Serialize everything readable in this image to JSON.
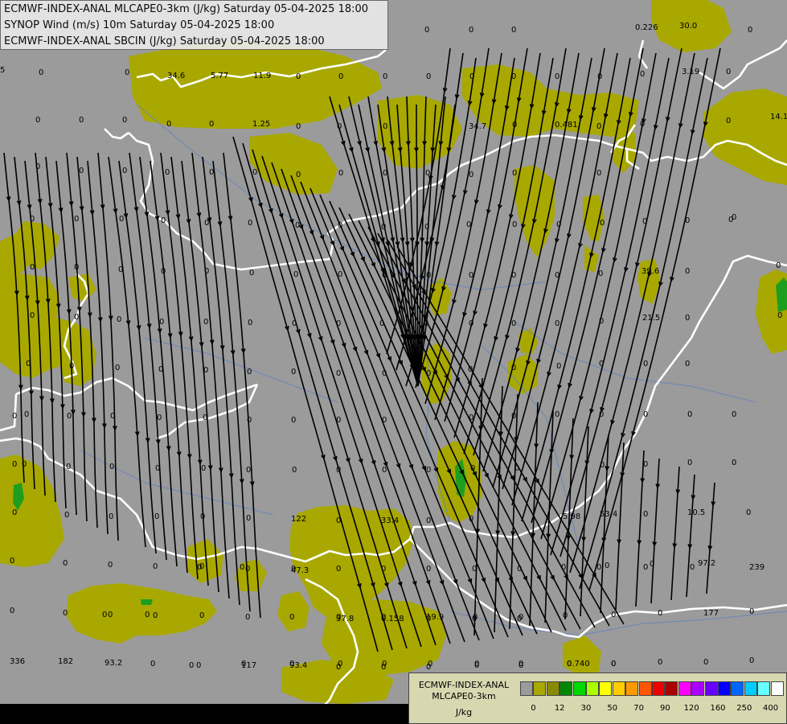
{
  "header": {
    "line1": "ECMWF-INDEX-ANAL MLCAPE0-3km (J/kg) Saturday 05-04-2025 18:00",
    "line2": "SYNOP Wind (m/s) 10m Saturday 05-04-2025 18:00",
    "line3": "ECMWF-INDEX-ANAL SBCIN (J/kg) Saturday 05-04-2025 18:00"
  },
  "legend": {
    "title1": "ECMWF-INDEX-ANAL",
    "title2": "MLCAPE0-3km",
    "units": "J/kg",
    "colors": [
      "#9b9b9b",
      "#a8a800",
      "#8a8a00",
      "#008800",
      "#00d800",
      "#aaff00",
      "#ffff00",
      "#ffcc00",
      "#ff9900",
      "#ff5500",
      "#ee0000",
      "#aa0000",
      "#ff00ff",
      "#aa00ff",
      "#6600ff",
      "#0000ff",
      "#0066ff",
      "#00ccff",
      "#66ffff",
      "#ffffff"
    ],
    "ticks": [
      "0",
      "12",
      "30",
      "50",
      "70",
      "90",
      "120",
      "160",
      "250",
      "400"
    ]
  },
  "colors": {
    "background": "#9b9b9b",
    "cape_low": "#a8a800",
    "cape_mid": "#1e9e1e",
    "border": "#ffffff",
    "rivers": "#6a87b8",
    "streamlines": "#000000"
  },
  "values": [
    {
      "t": "0"
    },
    {
      "t": "0"
    },
    {
      "t": "0"
    },
    {
      "t": "0.226"
    },
    {
      "t": "30.0"
    },
    {
      "t": "0"
    },
    {
      "t": "5"
    },
    {
      "t": "0"
    },
    {
      "t": "0"
    },
    {
      "t": "34.6"
    },
    {
      "t": "5.77"
    },
    {
      "t": "11.9"
    },
    {
      "t": "0"
    },
    {
      "t": "0"
    },
    {
      "t": "0"
    },
    {
      "t": "0"
    },
    {
      "t": "0"
    },
    {
      "t": "0"
    },
    {
      "t": "0"
    },
    {
      "t": "0"
    },
    {
      "t": "0"
    },
    {
      "t": "3.19"
    },
    {
      "t": "0"
    },
    {
      "t": "0"
    },
    {
      "t": "0"
    },
    {
      "t": "0"
    },
    {
      "t": "0"
    },
    {
      "t": "0"
    },
    {
      "t": "1.25"
    },
    {
      "t": "0"
    },
    {
      "t": "0"
    },
    {
      "t": "0"
    },
    {
      "t": "34.7"
    },
    {
      "t": "0"
    },
    {
      "t": "0.481"
    },
    {
      "t": "0"
    },
    {
      "t": "0"
    },
    {
      "t": "0"
    },
    {
      "t": "14.1"
    },
    {
      "t": "0"
    },
    {
      "t": "0"
    },
    {
      "t": "0"
    },
    {
      "t": "0"
    },
    {
      "t": "0"
    },
    {
      "t": "0"
    },
    {
      "t": "0"
    },
    {
      "t": "0"
    },
    {
      "t": "0"
    },
    {
      "t": "0"
    },
    {
      "t": "0"
    },
    {
      "t": "0"
    },
    {
      "t": "0"
    },
    {
      "t": "0"
    },
    {
      "t": "0"
    },
    {
      "t": "0"
    },
    {
      "t": "0"
    },
    {
      "t": "0"
    },
    {
      "t": "0"
    },
    {
      "t": "0"
    },
    {
      "t": "0"
    },
    {
      "t": "0"
    },
    {
      "t": "0"
    },
    {
      "t": "0"
    },
    {
      "t": "0"
    },
    {
      "t": "0"
    },
    {
      "t": "0"
    },
    {
      "t": "0"
    },
    {
      "t": "0"
    },
    {
      "t": "0"
    },
    {
      "t": "0"
    },
    {
      "t": "0"
    },
    {
      "t": "0"
    },
    {
      "t": "0"
    },
    {
      "t": "0"
    },
    {
      "t": "0"
    },
    {
      "t": "0"
    },
    {
      "t": "0"
    },
    {
      "t": "0"
    },
    {
      "t": "0"
    },
    {
      "t": "0"
    },
    {
      "t": "0"
    },
    {
      "t": "0"
    },
    {
      "t": "0"
    },
    {
      "t": "39.6"
    },
    {
      "t": "0"
    },
    {
      "t": "0"
    },
    {
      "t": "0"
    },
    {
      "t": "0"
    },
    {
      "t": "0"
    },
    {
      "t": "0"
    },
    {
      "t": "0"
    },
    {
      "t": "0"
    },
    {
      "t": "0"
    },
    {
      "t": "0"
    },
    {
      "t": "0"
    },
    {
      "t": "0"
    },
    {
      "t": "0"
    },
    {
      "t": "0"
    },
    {
      "t": "0"
    },
    {
      "t": "0"
    },
    {
      "t": "21.5"
    },
    {
      "t": "0"
    },
    {
      "t": "0"
    },
    {
      "t": "0"
    },
    {
      "t": "0"
    },
    {
      "t": "0"
    },
    {
      "t": "0"
    },
    {
      "t": "0"
    },
    {
      "t": "0"
    },
    {
      "t": "0"
    },
    {
      "t": "0"
    },
    {
      "t": "0"
    },
    {
      "t": "0"
    },
    {
      "t": "0"
    },
    {
      "t": "0"
    },
    {
      "t": "0"
    },
    {
      "t": "0"
    },
    {
      "t": "0"
    },
    {
      "t": "0"
    },
    {
      "t": "0"
    },
    {
      "t": "0"
    },
    {
      "t": "0"
    },
    {
      "t": "0"
    },
    {
      "t": "0"
    },
    {
      "t": "0"
    },
    {
      "t": "0"
    },
    {
      "t": "0"
    },
    {
      "t": "0"
    },
    {
      "t": "0"
    },
    {
      "t": "0"
    },
    {
      "t": "0"
    },
    {
      "t": "0"
    },
    {
      "t": "0"
    },
    {
      "t": "0"
    },
    {
      "t": "0"
    },
    {
      "t": "0"
    },
    {
      "t": "0"
    },
    {
      "t": "0"
    },
    {
      "t": "0"
    },
    {
      "t": "0"
    },
    {
      "t": "0"
    },
    {
      "t": "0"
    },
    {
      "t": "0"
    },
    {
      "t": "0"
    },
    {
      "t": "0"
    },
    {
      "t": "0"
    },
    {
      "t": "0"
    },
    {
      "t": "0"
    },
    {
      "t": "0"
    },
    {
      "t": "0"
    },
    {
      "t": "0"
    },
    {
      "t": "0"
    },
    {
      "t": "0"
    },
    {
      "t": "0"
    },
    {
      "t": "0"
    },
    {
      "t": "0"
    },
    {
      "t": "0"
    },
    {
      "t": "0"
    },
    {
      "t": "122"
    },
    {
      "t": "0"
    },
    {
      "t": "33.4"
    },
    {
      "t": "0"
    },
    {
      "t": "0"
    },
    {
      "t": "5.98"
    },
    {
      "t": "53.4"
    },
    {
      "t": "0"
    },
    {
      "t": "10.5"
    },
    {
      "t": "0"
    },
    {
      "t": "0"
    },
    {
      "t": "0"
    },
    {
      "t": "0"
    },
    {
      "t": "0"
    },
    {
      "t": "0"
    },
    {
      "t": "0"
    },
    {
      "t": "0"
    },
    {
      "t": "0"
    },
    {
      "t": "0"
    },
    {
      "t": "0"
    },
    {
      "t": "0"
    },
    {
      "t": "0"
    },
    {
      "t": "0"
    },
    {
      "t": "0"
    },
    {
      "t": "0"
    },
    {
      "t": "97.2"
    },
    {
      "t": "0"
    },
    {
      "t": "0"
    },
    {
      "t": "0"
    },
    {
      "t": "0"
    },
    {
      "t": "0"
    },
    {
      "t": "0"
    },
    {
      "t": "0"
    },
    {
      "t": "0"
    },
    {
      "t": "0"
    },
    {
      "t": "19.9"
    },
    {
      "t": "0"
    },
    {
      "t": "0"
    },
    {
      "t": "0"
    },
    {
      "t": "0"
    },
    {
      "t": "0"
    },
    {
      "t": "177"
    },
    {
      "t": "0"
    },
    {
      "t": "0"
    },
    {
      "t": "0"
    },
    {
      "t": "0"
    },
    {
      "t": "0"
    },
    {
      "t": "0"
    },
    {
      "t": "47.3"
    },
    {
      "t": "37.8"
    },
    {
      "t": "0.158"
    },
    {
      "t": "0"
    },
    {
      "t": "0"
    },
    {
      "t": "0"
    },
    {
      "t": "0"
    },
    {
      "t": "0"
    },
    {
      "t": "0"
    },
    {
      "t": "239"
    },
    {
      "t": "0"
    },
    {
      "t": "0"
    },
    {
      "t": "0"
    },
    {
      "t": "117"
    },
    {
      "t": "93.4"
    },
    {
      "t": "0"
    },
    {
      "t": "0"
    },
    {
      "t": "0"
    },
    {
      "t": "0"
    },
    {
      "t": "0"
    },
    {
      "t": "0.740"
    },
    {
      "t": "0"
    },
    {
      "t": "0"
    },
    {
      "t": "0"
    },
    {
      "t": "336"
    },
    {
      "t": "182"
    },
    {
      "t": "93.2"
    },
    {
      "t": "0"
    },
    {
      "t": "0"
    },
    {
      "t": "0"
    },
    {
      "t": "0"
    },
    {
      "t": "0"
    },
    {
      "t": "0"
    },
    {
      "t": "0"
    },
    {
      "t": "0"
    },
    {
      "t": "0"
    },
    {
      "t": "0"
    },
    {
      "t": "0"
    },
    {
      "t": "0"
    },
    {
      "t": "0"
    },
    {
      "t": "0"
    },
    {
      "t": "74.7"
    },
    {
      "t": "0"
    },
    {
      "t": "0"
    },
    {
      "t": "0"
    },
    {
      "t": "0"
    },
    {
      "t": "0"
    },
    {
      "t": "0"
    },
    {
      "t": "0"
    },
    {
      "t": "0"
    },
    {
      "t": "0"
    },
    {
      "t": "0"
    }
  ]
}
